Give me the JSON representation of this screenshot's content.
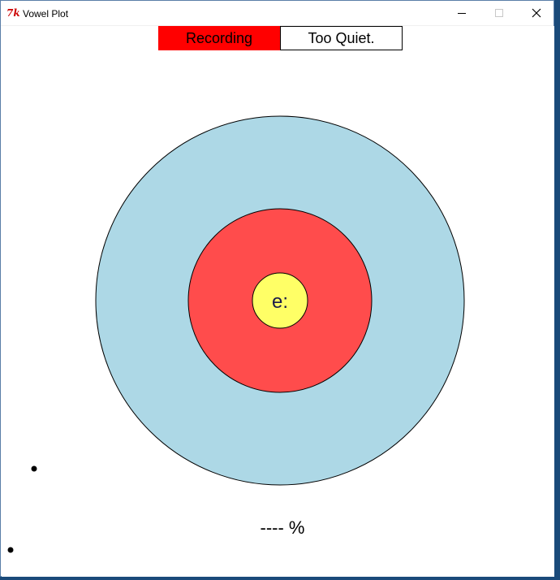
{
  "window": {
    "title": "Vowel Plot",
    "app_icon_glyph": "7k",
    "app_icon_name": "tk-feather-icon"
  },
  "status": {
    "recording_label": "Recording",
    "recording_color": "#ff0000",
    "volume_label": "Too Quiet."
  },
  "target": {
    "vowel": "e:",
    "outer_ring_color": "#add8e6",
    "middle_ring_color": "#ff4c4c",
    "inner_ring_color": "#ffff66"
  },
  "score": {
    "percent_text": "---- %"
  }
}
